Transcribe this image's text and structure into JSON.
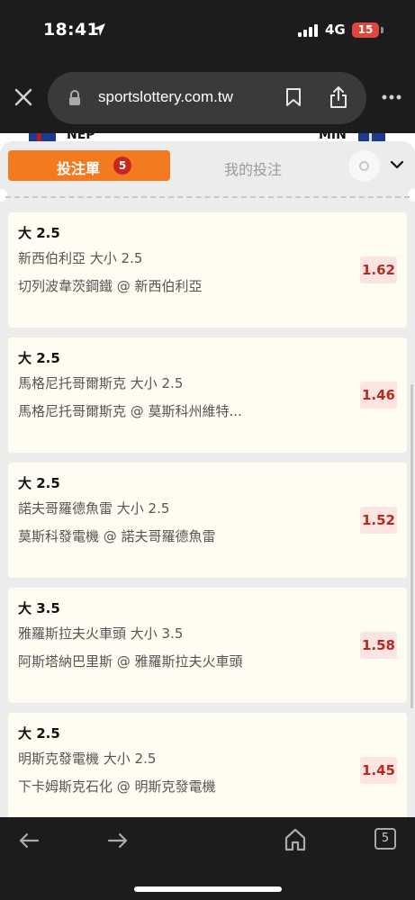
{
  "status": {
    "time": "18:41",
    "network": "4G",
    "battery": "15"
  },
  "browser": {
    "url": "sportslottery.com.tw",
    "tab_count": "5"
  },
  "teams": {
    "left": "NEP",
    "right": "MIN"
  },
  "tabs": {
    "active_label": "投注單",
    "active_badge": "5",
    "inactive_label": "我的投注"
  },
  "bets": [
    {
      "title": "大 2.5",
      "market": "新西伯利亞 大小 2.5",
      "match": "切列波韋茨鋼鐵 @ 新西伯利亞",
      "odds": "1.62"
    },
    {
      "title": "大 2.5",
      "market": "馬格尼托哥爾斯克 大小 2.5",
      "match": "馬格尼托哥爾斯克 @ 莫斯科州維特...",
      "odds": "1.46"
    },
    {
      "title": "大 2.5",
      "market": "諾夫哥羅德魚雷 大小 2.5",
      "match": "莫斯科發電機 @ 諾夫哥羅德魚雷",
      "odds": "1.52"
    },
    {
      "title": "大 3.5",
      "market": "雅羅斯拉夫火車頭 大小 3.5",
      "match": "阿斯塔納巴里斯 @ 雅羅斯拉夫火車頭",
      "odds": "1.58"
    },
    {
      "title": "大 2.5",
      "market": "明斯克發電機 大小 2.5",
      "match": "下卡姆斯克石化 @ 明斯克發電機",
      "odds": "1.45"
    }
  ],
  "colors": {
    "accent": "#f47a1f",
    "badge": "#c9271d",
    "odds_text": "#b52b20",
    "odds_bg": "#fbe5e2",
    "card_bg": "#fffdf2"
  },
  "icons": {
    "status": [
      "location-arrow-icon",
      "signal-icon",
      "battery-icon"
    ],
    "browser": [
      "close-icon",
      "lock-icon",
      "bookmark-icon",
      "share-icon",
      "more-icon"
    ],
    "toolbar": [
      "back-arrow-icon",
      "forward-arrow-icon",
      "home-icon",
      "tabs-icon"
    ],
    "sheet": [
      "settings-icon",
      "chevron-down-icon"
    ]
  }
}
